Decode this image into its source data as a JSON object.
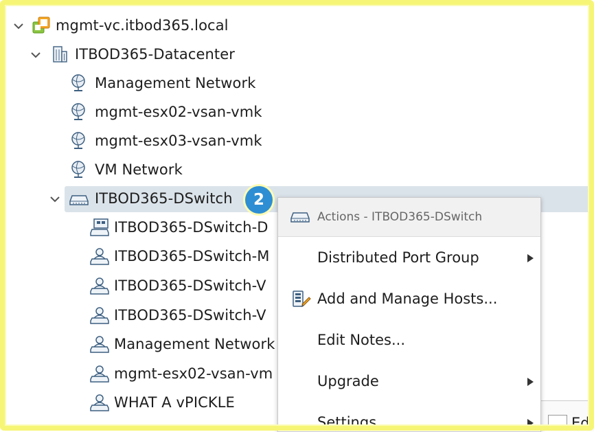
{
  "tree": {
    "rows": [
      {
        "label": "mgmt-vc.itbod365.local",
        "icon": "vcenter-icon",
        "expanded": true
      },
      {
        "label": "ITBOD365-Datacenter",
        "icon": "datacenter-icon",
        "expanded": true
      },
      {
        "label": "Management Network",
        "icon": "network-icon"
      },
      {
        "label": "mgmt-esx02-vsan-vmk",
        "icon": "network-icon"
      },
      {
        "label": "mgmt-esx03-vsan-vmk",
        "icon": "network-icon"
      },
      {
        "label": "VM Network",
        "icon": "network-icon"
      },
      {
        "label": "ITBOD365-DSwitch",
        "icon": "dswitch-icon",
        "expanded": true,
        "selected": true
      },
      {
        "label": "ITBOD365-DSwitch-D",
        "icon": "uplink-portgroup-icon"
      },
      {
        "label": "ITBOD365-DSwitch-M",
        "icon": "portgroup-icon"
      },
      {
        "label": "ITBOD365-DSwitch-V",
        "icon": "portgroup-icon"
      },
      {
        "label": "ITBOD365-DSwitch-V",
        "icon": "portgroup-icon"
      },
      {
        "label": "Management Network",
        "icon": "portgroup-icon"
      },
      {
        "label": "mgmt-esx02-vsan-vm",
        "icon": "portgroup-icon"
      },
      {
        "label": "WHAT A vPICKLE",
        "icon": "portgroup-icon"
      }
    ]
  },
  "callout": {
    "number": "2"
  },
  "context_menu": {
    "header": "Actions - ITBOD365-DSwitch",
    "items": [
      {
        "label": "Distributed Port Group",
        "submenu": true
      },
      {
        "label": "Add and Manage Hosts...",
        "icon": "add-hosts-icon"
      },
      {
        "label": "Edit Notes..."
      },
      {
        "label": "Upgrade",
        "submenu": true
      },
      {
        "label": "Settings",
        "submenu": true
      }
    ]
  },
  "corner_panel": {
    "label": "Edi"
  },
  "colors": {
    "selection": "#dbe3ea",
    "badge": "#2e8ed3",
    "frame": "#f7f576",
    "menu_header_bg": "#f1f1f1"
  }
}
